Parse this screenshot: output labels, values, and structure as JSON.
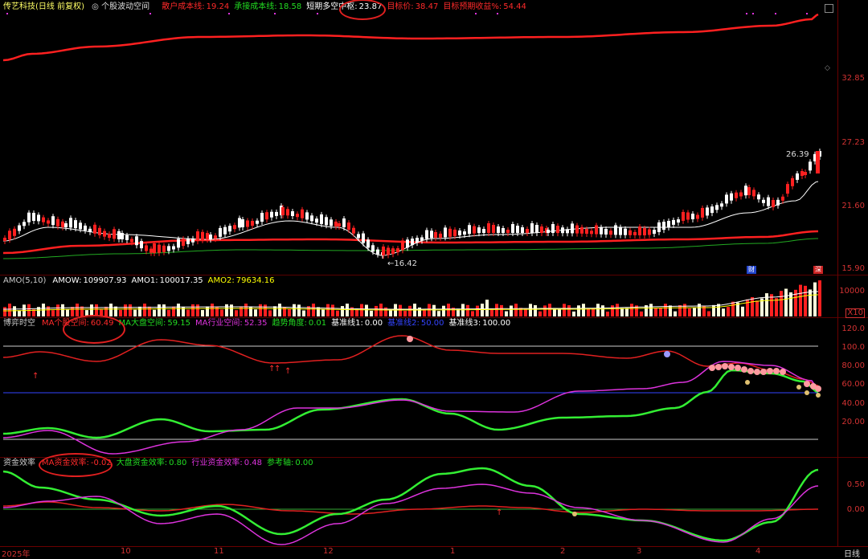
{
  "main_panel": {
    "stock_name": "传艺科技",
    "period": "(日线 前复权)",
    "indicator_name": "个股波动空间",
    "items": [
      {
        "label": "散户成本线:",
        "value": "19.24",
        "color": "#ff2a2a"
      },
      {
        "label": "承接成本线:",
        "value": "18.58",
        "color": "#22dd22"
      },
      {
        "label": "短期多空中枢:",
        "value": "23.87",
        "color": "#ffffff"
      },
      {
        "label": "目标价:",
        "value": "38.47",
        "color": "#ff2a2a"
      },
      {
        "label": "目标预期收益%:",
        "value": "54.44",
        "color": "#ff2a2a"
      }
    ],
    "y_ticks": [
      "32.85",
      "27.23",
      "21.60",
      "15.90"
    ],
    "high_label": "26.39",
    "low_label": "←16.42"
  },
  "amo_panel": {
    "items": [
      {
        "label": "AMO(5,10)",
        "value": "",
        "color": "#cccccc"
      },
      {
        "label": "AMOW:",
        "value": "109907.93",
        "color": "#ffffff"
      },
      {
        "label": "AMO1:",
        "value": "100017.35",
        "color": "#ffffff"
      },
      {
        "label": "AMO2:",
        "value": "79634.16",
        "color": "#ffff00"
      }
    ],
    "y_ticks": [
      "10000",
      "X10"
    ]
  },
  "game_panel": {
    "items": [
      {
        "label": "博弈时空",
        "value": "",
        "color": "#cccccc"
      },
      {
        "label": "MA个股空间:",
        "value": "60.49",
        "color": "#ff2a2a"
      },
      {
        "label": "MA大盘空间:",
        "value": "59.15",
        "color": "#22dd22"
      },
      {
        "label": "MA行业空间:",
        "value": "52.35",
        "color": "#dd33dd"
      },
      {
        "label": "趋势角度:",
        "value": "0.01",
        "color": "#22dd22"
      },
      {
        "label": "基准线1:",
        "value": "0.00",
        "color": "#ffffff"
      },
      {
        "label": "基准线2:",
        "value": "50.00",
        "color": "#3344ff"
      },
      {
        "label": "基准线3:",
        "value": "100.00",
        "color": "#ffffff"
      }
    ],
    "y_ticks": [
      "120.0",
      "100.0",
      "80.00",
      "60.00",
      "40.00",
      "20.00"
    ]
  },
  "fund_panel": {
    "items": [
      {
        "label": "资金效率",
        "value": "",
        "color": "#cccccc"
      },
      {
        "label": "MA资金效率:",
        "value": "-0.02",
        "color": "#ff2a2a"
      },
      {
        "label": "大盘资金效率:",
        "value": "0.80",
        "color": "#22dd22"
      },
      {
        "label": "行业资金效率:",
        "value": "0.48",
        "color": "#dd33dd"
      },
      {
        "label": "参考轴:",
        "value": "0.00",
        "color": "#22dd22"
      }
    ],
    "y_ticks": [
      "0.50",
      "0.00"
    ]
  },
  "x_axis": {
    "labels": [
      "2025年",
      "10",
      "11",
      "12",
      "1",
      "2",
      "3",
      "4"
    ],
    "period_label": "日线"
  },
  "event_flags": [
    "财",
    "深"
  ],
  "colors": {
    "up": "#ff2020",
    "down": "#00ffff",
    "axis": "#d23232"
  }
}
